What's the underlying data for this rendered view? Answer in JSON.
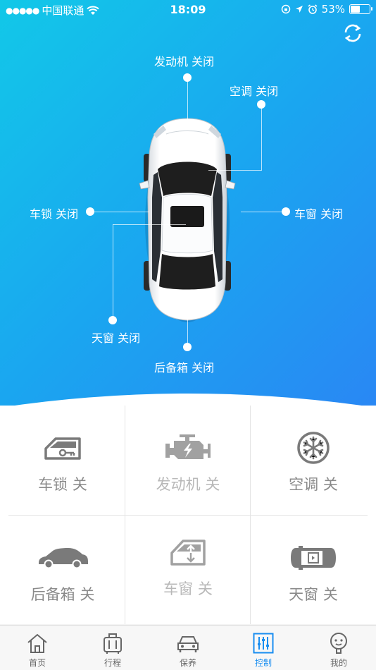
{
  "status_bar": {
    "signal": "●●●●●",
    "carrier": "中国联通",
    "time": "18:09",
    "battery_percent": "53%",
    "battery_level": 0.53
  },
  "car_status": {
    "engine": "发动机 关闭",
    "ac": "空调 关闭",
    "lock": "车锁 关闭",
    "window": "车窗 关闭",
    "sunroof": "天窗 关闭",
    "trunk": "后备箱 关闭"
  },
  "controls": [
    {
      "label": "车锁 关",
      "icon": "car-door-key-icon"
    },
    {
      "label": "发动机 关",
      "icon": "engine-icon"
    },
    {
      "label": "空调 关",
      "icon": "snowflake-icon"
    },
    {
      "label": "后备箱 关",
      "icon": "car-side-icon"
    },
    {
      "label": "车窗 关",
      "icon": "car-window-icon"
    },
    {
      "label": "天窗 关",
      "icon": "car-top-icon"
    }
  ],
  "tabs": [
    {
      "label": "首页",
      "icon": "home-icon"
    },
    {
      "label": "行程",
      "icon": "luggage-icon"
    },
    {
      "label": "保养",
      "icon": "car-front-icon"
    },
    {
      "label": "控制",
      "icon": "sliders-icon",
      "active": true
    },
    {
      "label": "我的",
      "icon": "profile-icon"
    }
  ],
  "colors": {
    "accent": "#1a8ef0",
    "hero_start": "#12c8e8",
    "hero_end": "#2a86f4"
  }
}
